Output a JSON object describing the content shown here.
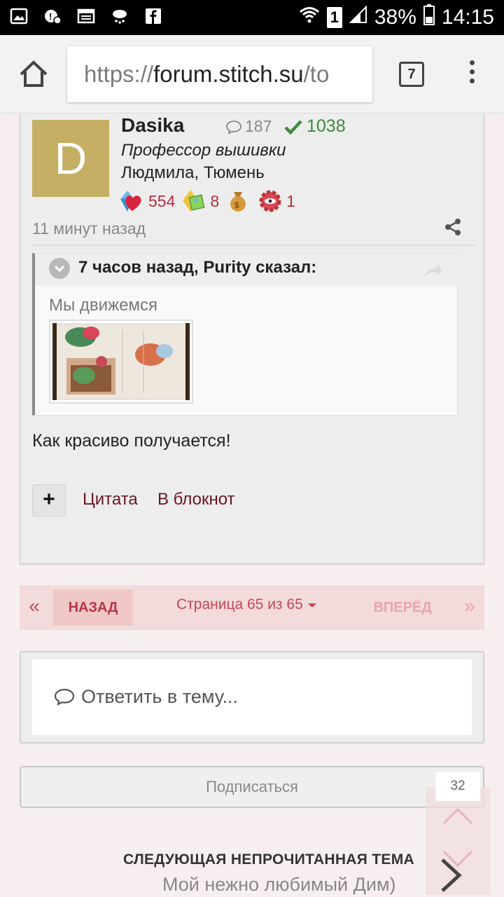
{
  "status_bar": {
    "battery_percent": "38%",
    "time": "14:15",
    "sim_slot": "1",
    "icons": [
      "gallery-icon",
      "weather-alert-icon",
      "news-icon",
      "cloud-rain-icon",
      "facebook-icon",
      "wifi-icon",
      "sim-icon",
      "signal-icon",
      "battery-icon"
    ]
  },
  "browser": {
    "url_scheme": "https://",
    "url_host": "forum.stitch.su",
    "url_rest": "/to",
    "tab_count": "7"
  },
  "post": {
    "avatar_letter": "D",
    "username": "Dasika",
    "post_count": "187",
    "reputation": "1038",
    "rank": "Профессор вышивки",
    "location": "Людмила, Тюмень",
    "awards": [
      {
        "icon": "heart-crystal-icon",
        "count": "554"
      },
      {
        "icon": "crystal-picture-icon",
        "count": "8"
      },
      {
        "icon": "money-bag-icon",
        "count": ""
      },
      {
        "icon": "gear-eye-icon",
        "count": "1"
      }
    ],
    "time_ago": "11 минут назад",
    "quote": {
      "header": "7 часов назад, Purity сказал:",
      "text": "Мы движемся"
    },
    "body": "Как красиво получается!",
    "actions": {
      "plus": "+",
      "quote": "Цитата",
      "notebook": "В блокнот"
    }
  },
  "pagination": {
    "first": "«",
    "prev": "НАЗАД",
    "info": "Страница 65 из 65",
    "next": "ВПЕРЁД",
    "last": "»"
  },
  "reply": {
    "placeholder": "Ответить в тему..."
  },
  "subscribe": {
    "label": "Подписаться",
    "count": "32"
  },
  "next_topic": {
    "label": "СЛЕДУЮЩАЯ НЕПРОЧИТАННАЯ ТЕМА",
    "title": "Мой нежно любимый Дим)"
  },
  "colors": {
    "accent": "#c44658",
    "link": "#6c1525",
    "avatar": "#c4af64",
    "reputation": "#3d8a3d"
  }
}
